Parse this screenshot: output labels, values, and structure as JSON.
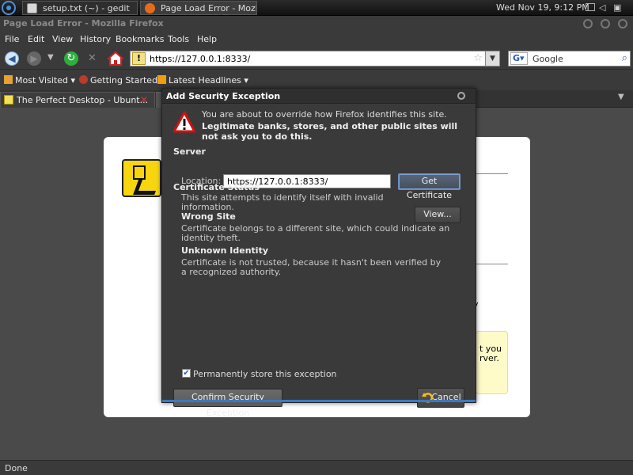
{
  "panel": {
    "tasks": [
      {
        "label": "setup.txt (~) - gedit"
      },
      {
        "label": "Page Load Error - Mozi..."
      }
    ],
    "clock": "Wed Nov 19,  9:12 PM"
  },
  "window": {
    "title": "Page Load Error - Mozilla Firefox"
  },
  "menu": {
    "items": [
      "File",
      "Edit",
      "View",
      "History",
      "Bookmarks",
      "Tools",
      "Help"
    ]
  },
  "navbar": {
    "url": "https://127.0.0.1:8333/",
    "search_engine_glyph": "G",
    "search_text": "Google"
  },
  "bookmarks": {
    "items": [
      "Most Visited",
      "Getting Started",
      "Latest Headlines"
    ]
  },
  "tabs": [
    {
      "label": "The Perfect Desktop - Ubunt..."
    }
  ],
  "page": {
    "partial_text_1": "y",
    "partial_text_2": "t you",
    "partial_text_3": "rver."
  },
  "dialog": {
    "title": "Add Security Exception",
    "intro": "You are about to override how Firefox identifies this site.",
    "warning": "Legitimate banks, stores, and other public sites will not ask you to do this.",
    "server_heading": "Server",
    "location_label": "Location:",
    "location_value": "https://127.0.0.1:8333/",
    "get_cert_label": "Get Certificate",
    "status_heading": "Certificate Status",
    "status_text": "This site attempts to identify itself with invalid information.",
    "view_label": "View...",
    "wrong_site_heading": "Wrong Site",
    "wrong_site_text": "Certificate belongs to a different site, which could indicate an identity theft.",
    "unknown_heading": "Unknown Identity",
    "unknown_text": "Certificate is not trusted, because it hasn't been verified by a recognized authority.",
    "persist_label": "Permanently store this exception",
    "persist_checked": true,
    "confirm_label": "Confirm Security Exception",
    "cancel_label": "Cancel"
  },
  "status_bar": {
    "text": "Done"
  },
  "colors": {
    "accent": "#3b79c2",
    "dialog_bg": "#3a3a3a",
    "page_bg": "#4a4a4a"
  }
}
